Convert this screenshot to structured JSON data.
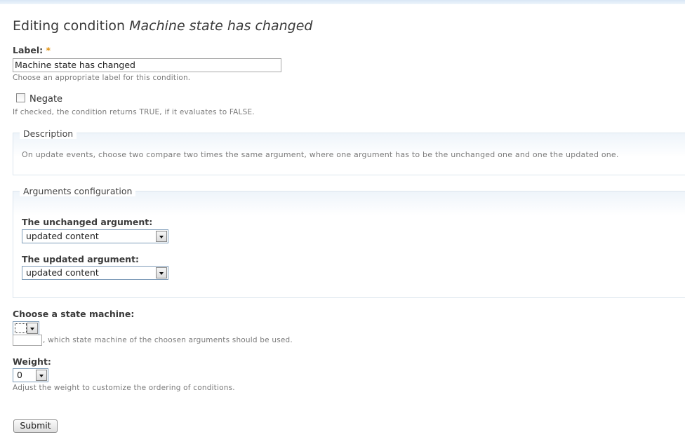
{
  "page": {
    "title_prefix": "Editing condition",
    "title_condition": "Machine state has changed"
  },
  "label_field": {
    "label": "Label:",
    "required_marker": "*",
    "value": "Machine state has changed",
    "help": "Choose an appropriate label for this condition."
  },
  "negate": {
    "label": "Negate",
    "checked": false,
    "help": "If checked, the condition returns TRUE, if it evaluates to FALSE."
  },
  "description_fieldset": {
    "legend": "Description",
    "text": "On update events, choose two compare two times the same argument, where one argument has to be the unchanged one and one the updated one."
  },
  "arguments_fieldset": {
    "legend": "Arguments configuration",
    "unchanged": {
      "label": "The unchanged argument:",
      "selected": "updated content"
    },
    "updated": {
      "label": "The updated argument:",
      "selected": "updated content"
    }
  },
  "state_machine": {
    "label": "Choose a state machine:",
    "selected": "",
    "help": ", which state machine of the choosen arguments should be used."
  },
  "weight": {
    "label": "Weight:",
    "selected": "0",
    "help": "Adjust the weight to customize the ordering of conditions."
  },
  "submit": {
    "label": "Submit"
  },
  "colors": {
    "required": "#e09010",
    "select_border": "#7f9db9",
    "fieldset_border": "#dde6ee",
    "top_bar": "#d8e7f5"
  }
}
